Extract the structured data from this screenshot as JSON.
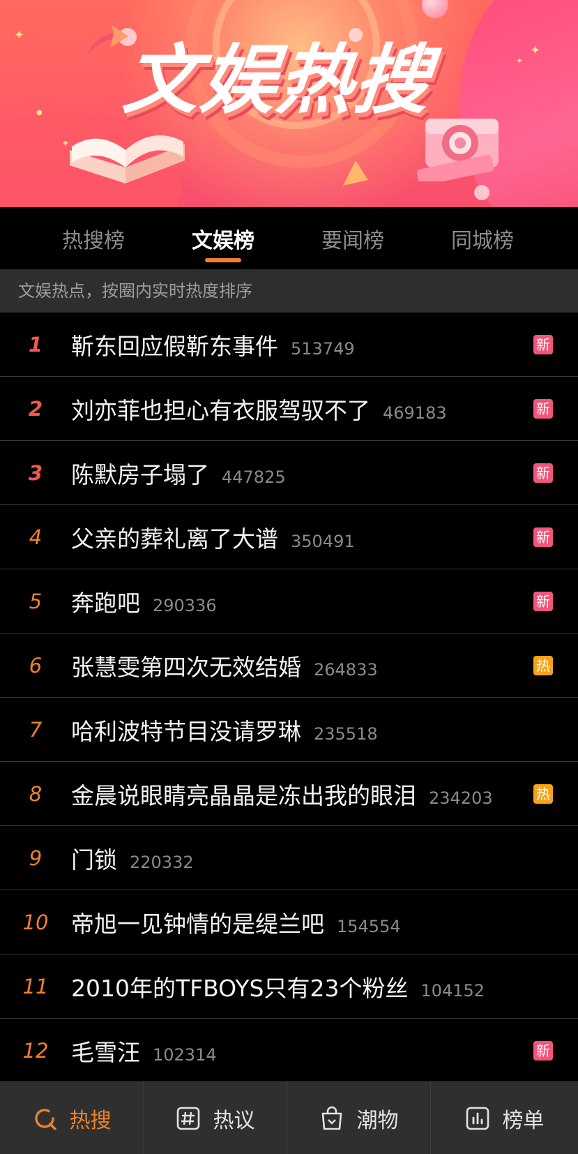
{
  "banner": {
    "title": "文娱热搜"
  },
  "tabs": [
    {
      "label": "热搜榜",
      "active": false
    },
    {
      "label": "文娱榜",
      "active": true
    },
    {
      "label": "要闻榜",
      "active": false
    },
    {
      "label": "同城榜",
      "active": false
    }
  ],
  "subtitle": "文娱热点，按圈内实时热度排序",
  "items": [
    {
      "rank": "1",
      "title": "靳东回应假靳东事件",
      "count": "513749",
      "badge": "新",
      "badge_type": "new"
    },
    {
      "rank": "2",
      "title": "刘亦菲也担心有衣服驾驭不了",
      "count": "469183",
      "badge": "新",
      "badge_type": "new"
    },
    {
      "rank": "3",
      "title": "陈默房子塌了",
      "count": "447825",
      "badge": "新",
      "badge_type": "new"
    },
    {
      "rank": "4",
      "title": "父亲的葬礼离了大谱",
      "count": "350491",
      "badge": "新",
      "badge_type": "new"
    },
    {
      "rank": "5",
      "title": "奔跑吧",
      "count": "290336",
      "badge": "新",
      "badge_type": "new"
    },
    {
      "rank": "6",
      "title": "张慧雯第四次无效结婚",
      "count": "264833",
      "badge": "热",
      "badge_type": "hot"
    },
    {
      "rank": "7",
      "title": "哈利波特节目没请罗琳",
      "count": "235518",
      "badge": "",
      "badge_type": ""
    },
    {
      "rank": "8",
      "title": "金晨说眼睛亮晶晶是冻出我的眼泪",
      "count": "234203",
      "badge": "热",
      "badge_type": "hot"
    },
    {
      "rank": "9",
      "title": "门锁",
      "count": "220332",
      "badge": "",
      "badge_type": ""
    },
    {
      "rank": "10",
      "title": "帝旭一见钟情的是缇兰吧",
      "count": "154554",
      "badge": "",
      "badge_type": ""
    },
    {
      "rank": "11",
      "title": "2010年的TFBOYS只有23个粉丝",
      "count": "104152",
      "badge": "",
      "badge_type": ""
    },
    {
      "rank": "12",
      "title": "毛雪汪",
      "count": "102314",
      "badge": "新",
      "badge_type": "new"
    }
  ],
  "nav": [
    {
      "label": "热搜",
      "icon": "search-refresh-icon",
      "active": true
    },
    {
      "label": "热议",
      "icon": "hashtag-icon",
      "active": false
    },
    {
      "label": "潮物",
      "icon": "shopping-bag-icon",
      "active": false
    },
    {
      "label": "榜单",
      "icon": "bar-chart-icon",
      "active": false
    }
  ],
  "colors": {
    "accent": "#f08128",
    "top_rank": "#f2584f",
    "badge_new": "#f0567a",
    "badge_hot": "#f7a21c",
    "background": "#000000"
  }
}
